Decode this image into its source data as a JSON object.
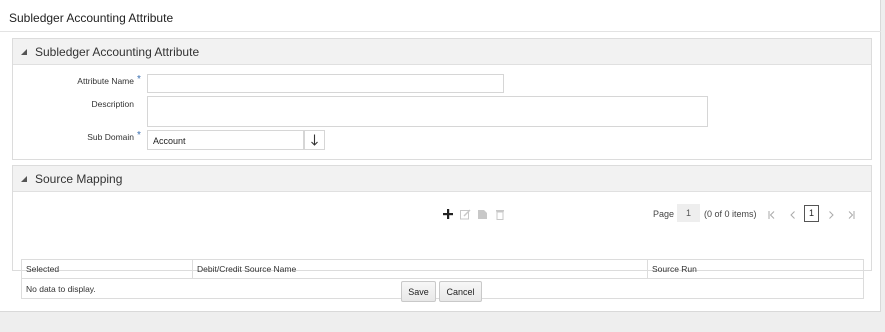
{
  "page": {
    "title": "Subledger Accounting Attribute"
  },
  "attribute_section": {
    "title": "Subledger Accounting Attribute",
    "attribute_name": {
      "label": "Attribute Name",
      "required_mark": "*",
      "value": ""
    },
    "description": {
      "label": "Description",
      "value": ""
    },
    "sub_domain": {
      "label": "Sub Domain",
      "required_mark": "*",
      "value": "Account"
    }
  },
  "source_mapping": {
    "title": "Source Mapping",
    "toolbar": {
      "add": "add-icon",
      "edit": "edit-icon",
      "copy": "copy-icon",
      "delete": "delete-icon"
    },
    "pager": {
      "page_label": "Page",
      "page_value": "1",
      "count_text": "(0 of 0 items)",
      "current_page": "1"
    },
    "table": {
      "columns": [
        "Selected",
        "Debit/Credit Source Name",
        "Source Run"
      ],
      "empty_text": "No data to display."
    }
  },
  "actions": {
    "save": "Save",
    "cancel": "Cancel"
  }
}
